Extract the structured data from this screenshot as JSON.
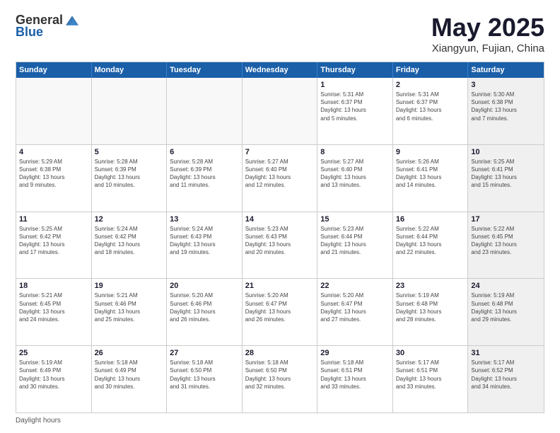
{
  "header": {
    "logo_general": "General",
    "logo_blue": "Blue",
    "main_title": "May 2025",
    "subtitle": "Xiangyun, Fujian, China"
  },
  "footer": {
    "note": "Daylight hours"
  },
  "calendar": {
    "days_of_week": [
      "Sunday",
      "Monday",
      "Tuesday",
      "Wednesday",
      "Thursday",
      "Friday",
      "Saturday"
    ],
    "rows": [
      [
        {
          "day": "",
          "info": "",
          "empty": true
        },
        {
          "day": "",
          "info": "",
          "empty": true
        },
        {
          "day": "",
          "info": "",
          "empty": true
        },
        {
          "day": "",
          "info": "",
          "empty": true
        },
        {
          "day": "1",
          "info": "Sunrise: 5:31 AM\nSunset: 6:37 PM\nDaylight: 13 hours\nand 5 minutes."
        },
        {
          "day": "2",
          "info": "Sunrise: 5:31 AM\nSunset: 6:37 PM\nDaylight: 13 hours\nand 6 minutes."
        },
        {
          "day": "3",
          "info": "Sunrise: 5:30 AM\nSunset: 6:38 PM\nDaylight: 13 hours\nand 7 minutes.",
          "shaded": true
        }
      ],
      [
        {
          "day": "4",
          "info": "Sunrise: 5:29 AM\nSunset: 6:38 PM\nDaylight: 13 hours\nand 9 minutes."
        },
        {
          "day": "5",
          "info": "Sunrise: 5:28 AM\nSunset: 6:39 PM\nDaylight: 13 hours\nand 10 minutes."
        },
        {
          "day": "6",
          "info": "Sunrise: 5:28 AM\nSunset: 6:39 PM\nDaylight: 13 hours\nand 11 minutes."
        },
        {
          "day": "7",
          "info": "Sunrise: 5:27 AM\nSunset: 6:40 PM\nDaylight: 13 hours\nand 12 minutes."
        },
        {
          "day": "8",
          "info": "Sunrise: 5:27 AM\nSunset: 6:40 PM\nDaylight: 13 hours\nand 13 minutes."
        },
        {
          "day": "9",
          "info": "Sunrise: 5:26 AM\nSunset: 6:41 PM\nDaylight: 13 hours\nand 14 minutes."
        },
        {
          "day": "10",
          "info": "Sunrise: 5:25 AM\nSunset: 6:41 PM\nDaylight: 13 hours\nand 15 minutes.",
          "shaded": true
        }
      ],
      [
        {
          "day": "11",
          "info": "Sunrise: 5:25 AM\nSunset: 6:42 PM\nDaylight: 13 hours\nand 17 minutes."
        },
        {
          "day": "12",
          "info": "Sunrise: 5:24 AM\nSunset: 6:42 PM\nDaylight: 13 hours\nand 18 minutes."
        },
        {
          "day": "13",
          "info": "Sunrise: 5:24 AM\nSunset: 6:43 PM\nDaylight: 13 hours\nand 19 minutes."
        },
        {
          "day": "14",
          "info": "Sunrise: 5:23 AM\nSunset: 6:43 PM\nDaylight: 13 hours\nand 20 minutes."
        },
        {
          "day": "15",
          "info": "Sunrise: 5:23 AM\nSunset: 6:44 PM\nDaylight: 13 hours\nand 21 minutes."
        },
        {
          "day": "16",
          "info": "Sunrise: 5:22 AM\nSunset: 6:44 PM\nDaylight: 13 hours\nand 22 minutes."
        },
        {
          "day": "17",
          "info": "Sunrise: 5:22 AM\nSunset: 6:45 PM\nDaylight: 13 hours\nand 23 minutes.",
          "shaded": true
        }
      ],
      [
        {
          "day": "18",
          "info": "Sunrise: 5:21 AM\nSunset: 6:45 PM\nDaylight: 13 hours\nand 24 minutes."
        },
        {
          "day": "19",
          "info": "Sunrise: 5:21 AM\nSunset: 6:46 PM\nDaylight: 13 hours\nand 25 minutes."
        },
        {
          "day": "20",
          "info": "Sunrise: 5:20 AM\nSunset: 6:46 PM\nDaylight: 13 hours\nand 26 minutes."
        },
        {
          "day": "21",
          "info": "Sunrise: 5:20 AM\nSunset: 6:47 PM\nDaylight: 13 hours\nand 26 minutes."
        },
        {
          "day": "22",
          "info": "Sunrise: 5:20 AM\nSunset: 6:47 PM\nDaylight: 13 hours\nand 27 minutes."
        },
        {
          "day": "23",
          "info": "Sunrise: 5:19 AM\nSunset: 6:48 PM\nDaylight: 13 hours\nand 28 minutes."
        },
        {
          "day": "24",
          "info": "Sunrise: 5:19 AM\nSunset: 6:48 PM\nDaylight: 13 hours\nand 29 minutes.",
          "shaded": true
        }
      ],
      [
        {
          "day": "25",
          "info": "Sunrise: 5:19 AM\nSunset: 6:49 PM\nDaylight: 13 hours\nand 30 minutes."
        },
        {
          "day": "26",
          "info": "Sunrise: 5:18 AM\nSunset: 6:49 PM\nDaylight: 13 hours\nand 30 minutes."
        },
        {
          "day": "27",
          "info": "Sunrise: 5:18 AM\nSunset: 6:50 PM\nDaylight: 13 hours\nand 31 minutes."
        },
        {
          "day": "28",
          "info": "Sunrise: 5:18 AM\nSunset: 6:50 PM\nDaylight: 13 hours\nand 32 minutes."
        },
        {
          "day": "29",
          "info": "Sunrise: 5:18 AM\nSunset: 6:51 PM\nDaylight: 13 hours\nand 33 minutes."
        },
        {
          "day": "30",
          "info": "Sunrise: 5:17 AM\nSunset: 6:51 PM\nDaylight: 13 hours\nand 33 minutes."
        },
        {
          "day": "31",
          "info": "Sunrise: 5:17 AM\nSunset: 6:52 PM\nDaylight: 13 hours\nand 34 minutes.",
          "shaded": true
        }
      ]
    ]
  }
}
